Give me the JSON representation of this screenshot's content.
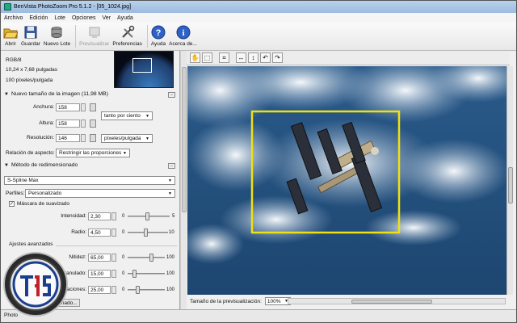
{
  "window": {
    "title": "BenVista PhotoZoom Pro 5.1.2 - [05_1024.jpg]"
  },
  "menu": [
    "Archivo",
    "Edición",
    "Lote",
    "Opciones",
    "Ver",
    "Ayuda"
  ],
  "toolbar": {
    "open": "Abrir",
    "save": "Guardar",
    "new_batch": "Nuevo Lote",
    "preview": "Previsualizar",
    "preferences": "Preferencias",
    "help": "Ayuda",
    "about": "Acerca de..."
  },
  "info": {
    "color_mode": "RGB/8",
    "size_inches": "10,24 x 7,68 pulgadas",
    "resolution": "100 píxeles/pulgada"
  },
  "new_size": {
    "header": "Nuevo tamaño de la imagen (11,98 MB)",
    "width_label": "Anchura:",
    "width_value": "158",
    "height_label": "Altura:",
    "height_value": "158",
    "resolution_label": "Resolución:",
    "resolution_value": "146",
    "unit_percent": "tanto por ciento",
    "unit_resolution": "píxeles/pulgada",
    "aspect_label": "Relación de aspecto:",
    "aspect_value": "Restringir las proporciones"
  },
  "method": {
    "header": "Método de redimensionado",
    "algorithm": "S-Spline Max",
    "profile_label": "Perfiles:",
    "profile_value": "Personalizado",
    "mask_label": "Máscara de suavizado",
    "intensity_label": "Intensidad:",
    "intensity_value": "2,30",
    "radius_label": "Radio:",
    "radius_value": "4,50",
    "intensity_min": "0",
    "intensity_max": "5",
    "intensity_level": 0.46,
    "radius_min": "0",
    "radius_max": "10",
    "radius_level": 0.45,
    "advanced_header": "Ajustes avanzados",
    "sharpness_label": "Nitidez:",
    "sharpness_value": "65,00",
    "sharpness_level": 0.65,
    "grain_label": "Granulado:",
    "grain_value": "15,00",
    "grain_level": 0.15,
    "artifacts_label": "Aberraciones:",
    "artifacts_value": "25,00",
    "artifacts_level": 0.25,
    "adv_min": "0",
    "adv_max": "100",
    "more_button": "Predeterminado..."
  },
  "preview_bar": {
    "label": "Tamaño de la previsualización:",
    "zoom": "100%"
  },
  "status": {
    "text": "Photo"
  },
  "colors": {
    "selection": "#f0e010",
    "sky_dark": "#1f4a78",
    "cloud": "#e8eef4"
  }
}
